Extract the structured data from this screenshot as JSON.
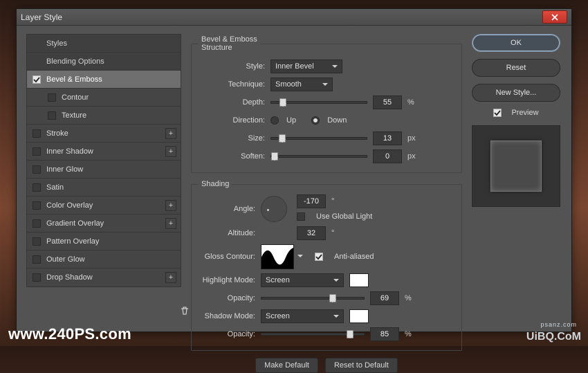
{
  "titlebar": {
    "title": "Layer Style"
  },
  "sidebar": {
    "styles": "Styles",
    "blending": "Blending Options",
    "bevel": "Bevel & Emboss",
    "contour": "Contour",
    "texture": "Texture",
    "stroke": "Stroke",
    "innerShadow": "Inner Shadow",
    "innerGlow": "Inner Glow",
    "satin": "Satin",
    "colorOverlay": "Color Overlay",
    "gradientOverlay": "Gradient Overlay",
    "patternOverlay": "Pattern Overlay",
    "outerGlow": "Outer Glow",
    "dropShadow": "Drop Shadow"
  },
  "bevel": {
    "section": "Bevel & Emboss",
    "structure": "Structure",
    "styleLbl": "Style:",
    "styleVal": "Inner Bevel",
    "techLbl": "Technique:",
    "techVal": "Smooth",
    "depthLbl": "Depth:",
    "depthVal": "55",
    "depthUnit": "%",
    "dirLbl": "Direction:",
    "up": "Up",
    "down": "Down",
    "sizeLbl": "Size:",
    "sizeVal": "13",
    "px": "px",
    "softenLbl": "Soften:",
    "softenVal": "0"
  },
  "shading": {
    "section": "Shading",
    "angleLbl": "Angle:",
    "angleVal": "-170",
    "deg": "°",
    "globalLbl": "Use Global Light",
    "altitudeLbl": "Altitude:",
    "altitudeVal": "32",
    "glossLbl": "Gloss Contour:",
    "aaLbl": "Anti-aliased",
    "hlLbl": "Highlight Mode:",
    "hlVal": "Screen",
    "opacityLbl": "Opacity:",
    "hlOpacity": "69",
    "pct": "%",
    "shLbl": "Shadow Mode:",
    "shVal": "Screen",
    "shOpacity": "85"
  },
  "buttons": {
    "makeDefault": "Make Default",
    "resetDefault": "Reset to Default",
    "ok": "OK",
    "reset": "Reset",
    "newStyle": "New Style...",
    "preview": "Preview"
  },
  "watermark": {
    "a": "www.240PS.com",
    "b": "UiBQ.CoM",
    "c": "psanz.com"
  }
}
